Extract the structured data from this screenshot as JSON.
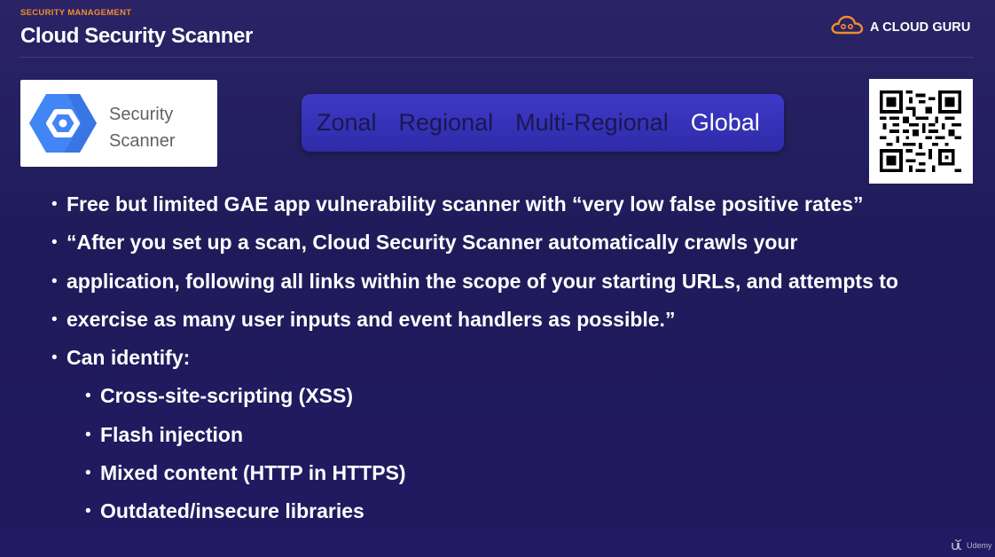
{
  "header": {
    "kicker": "SECURITY MANAGEMENT",
    "title": "Cloud Security Scanner"
  },
  "brand": {
    "logo_icon": "cloud-icon",
    "label": "A CLOUD GURU"
  },
  "product_card": {
    "icon": "security-scanner-hex-icon",
    "name_line1": "Security",
    "name_line2": "Scanner"
  },
  "scope_bar": {
    "items": [
      "Zonal",
      "Regional",
      "Multi-Regional",
      "Global"
    ],
    "active": "Global"
  },
  "qr_code": {
    "icon": "qr-code-icon"
  },
  "bullets": [
    {
      "text": "Free but limited GAE app vulnerability scanner with “very low false positive rates”",
      "level": 1
    },
    {
      "text": "“After you set up a scan, Cloud Security Scanner automatically crawls your",
      "level": 1
    },
    {
      "text": "application, following all links within the scope of your starting URLs, and attempts to",
      "level": 1,
      "continuation": true
    },
    {
      "text": "exercise as many user inputs and event handlers as possible.”",
      "level": 1,
      "continuation": true
    },
    {
      "text": "Can identify:",
      "level": 1
    },
    {
      "text": "Cross-site-scripting (XSS)",
      "level": 2
    },
    {
      "text": "Flash injection",
      "level": 2
    },
    {
      "text": "Mixed content (HTTP in HTTPS)",
      "level": 2
    },
    {
      "text": "Outdated/insecure libraries",
      "level": 2
    }
  ],
  "footer": {
    "watermark": "Udemy",
    "watermark_icon": "udemy-logo-icon"
  },
  "colors": {
    "background": "#221d5e",
    "kicker": "#f48c2a",
    "brand_cloud": "#f48c2a",
    "scope_bar": "#3a36c0",
    "scope_inactive_text": "#1a1750",
    "product_hex": "#4285f4"
  }
}
